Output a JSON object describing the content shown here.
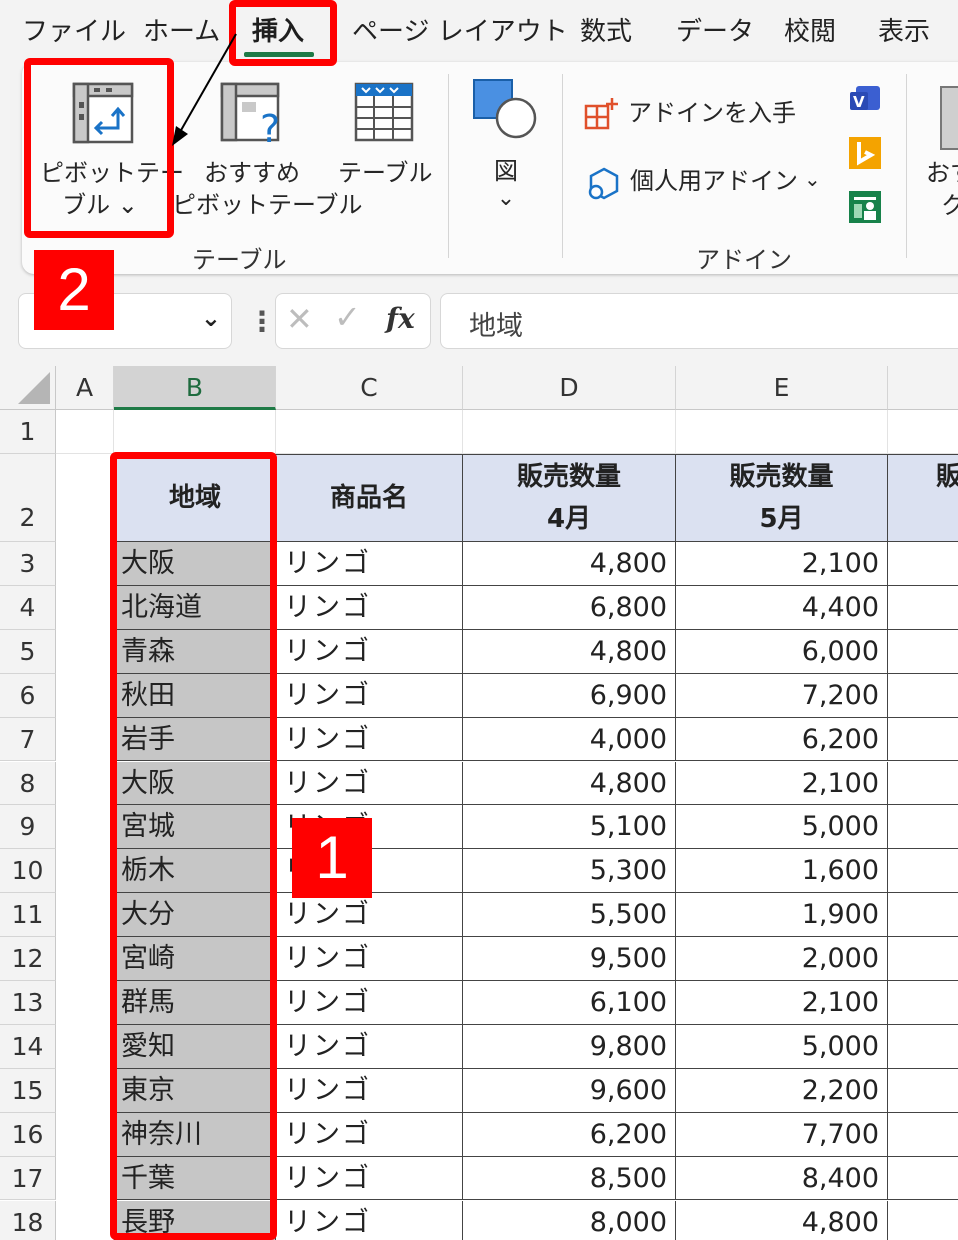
{
  "menu": {
    "tabs": [
      "ファイル",
      "ホーム",
      "挿入",
      "ページ レイアウト",
      "数式",
      "データ",
      "校閲",
      "表示"
    ],
    "active_tab": "挿入"
  },
  "ribbon": {
    "pivot_table": {
      "line1": "ピボットテー",
      "line2": "ブル ⌄"
    },
    "recommended_pivot": {
      "line1": "おすすめ",
      "line2": "ピボットテーブル"
    },
    "table": "テーブル",
    "figure": {
      "label": "図",
      "chevron": "⌄"
    },
    "group_table": "テーブル",
    "get_addins": "アドインを入手",
    "my_addins": "個人用アドイン",
    "group_addins": "アドイン",
    "cut_label_1": "おす",
    "cut_label_2": "グ"
  },
  "formula_bar": {
    "name_box_value": "",
    "content": "地域",
    "fx_label": "fx"
  },
  "annotations": {
    "step1": "1",
    "step2": "2"
  },
  "sheet": {
    "columns": [
      "A",
      "B",
      "C",
      "D",
      "E"
    ],
    "selected_column": "B",
    "row_numbers": [
      "1",
      "2",
      "3",
      "4",
      "5",
      "6",
      "7",
      "8",
      "9",
      "10",
      "11",
      "12",
      "13",
      "14",
      "15",
      "16",
      "17",
      "18"
    ],
    "headers": {
      "region": "地域",
      "product": "商品名",
      "qty_apr_1": "販売数量",
      "qty_apr_2": "4月",
      "qty_may_1": "販売数量",
      "qty_may_2": "5月",
      "next_cut": "販"
    },
    "rows": [
      {
        "region": "大阪",
        "product": "リンゴ",
        "apr": "4,800",
        "may": "2,100"
      },
      {
        "region": "北海道",
        "product": "リンゴ",
        "apr": "6,800",
        "may": "4,400"
      },
      {
        "region": "青森",
        "product": "リンゴ",
        "apr": "4,800",
        "may": "6,000"
      },
      {
        "region": "秋田",
        "product": "リンゴ",
        "apr": "6,900",
        "may": "7,200"
      },
      {
        "region": "岩手",
        "product": "リンゴ",
        "apr": "4,000",
        "may": "6,200"
      },
      {
        "region": "大阪",
        "product": "リンゴ",
        "apr": "4,800",
        "may": "2,100"
      },
      {
        "region": "宮城",
        "product": "リンゴ",
        "apr": "5,100",
        "may": "5,000"
      },
      {
        "region": "栃木",
        "product": "リンゴ",
        "apr": "5,300",
        "may": "1,600"
      },
      {
        "region": "大分",
        "product": "リンゴ",
        "apr": "5,500",
        "may": "1,900"
      },
      {
        "region": "宮崎",
        "product": "リンゴ",
        "apr": "9,500",
        "may": "2,000"
      },
      {
        "region": "群馬",
        "product": "リンゴ",
        "apr": "6,100",
        "may": "2,100"
      },
      {
        "region": "愛知",
        "product": "リンゴ",
        "apr": "9,800",
        "may": "5,000"
      },
      {
        "region": "東京",
        "product": "リンゴ",
        "apr": "9,600",
        "may": "2,200"
      },
      {
        "region": "神奈川",
        "product": "リンゴ",
        "apr": "6,200",
        "may": "7,700"
      },
      {
        "region": "千葉",
        "product": "リンゴ",
        "apr": "8,500",
        "may": "8,400"
      },
      {
        "region": "長野",
        "product": "リンゴ",
        "apr": "8,000",
        "may": "4,800"
      }
    ]
  },
  "colors": {
    "excel_green": "#1e7a46",
    "highlight_red": "#ff0000",
    "header_fill": "#dbe1f1",
    "selection_gray": "#c6c6c6"
  }
}
